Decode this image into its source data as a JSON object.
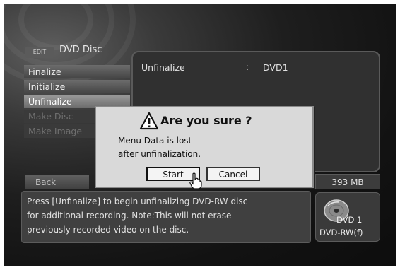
{
  "menu": {
    "badge": "EDIT",
    "title": "DVD Disc",
    "items": [
      {
        "label": "Finalize",
        "state": "enabled"
      },
      {
        "label": "Initialize",
        "state": "enabled"
      },
      {
        "label": "Unfinalize",
        "state": "selected"
      },
      {
        "label": "Make Disc",
        "state": "disabled"
      },
      {
        "label": "Make Image",
        "state": "disabled"
      }
    ]
  },
  "info": {
    "label": "Unfinalize",
    "separator": ":",
    "value": "DVD1"
  },
  "back_label": "Back",
  "capacity": "393 MB",
  "help_lines": [
    "Press [Unfinalize] to begin unfinalizing DVD-RW disc",
    "for additional recording. Note:This will not erase",
    "previously recorded video on the disc."
  ],
  "disc": {
    "label": "DVD 1",
    "type": "DVD-RW(f)",
    "icon": "disc-icon"
  },
  "dialog": {
    "title": "Are you sure ?",
    "icon": "warning-icon",
    "message_lines": [
      "Menu Data is lost",
      "after unfinalization."
    ],
    "start_label": "Start",
    "cancel_label": "Cancel"
  },
  "cursor_icon": "hand-pointer-icon"
}
